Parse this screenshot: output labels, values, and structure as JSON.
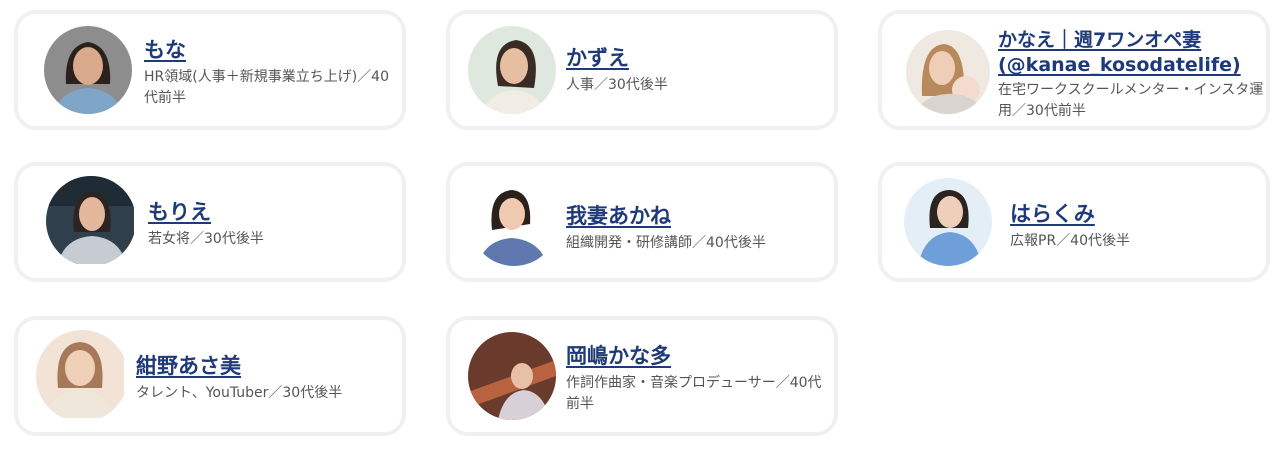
{
  "profiles": [
    {
      "name": "もな",
      "description": "HR領域(人事＋新規事業立ち上げ)／40代前半",
      "avatar_icon": "person-portrait-icon"
    },
    {
      "name": "かずえ",
      "description": "人事／30代後半",
      "avatar_icon": "person-portrait-icon"
    },
    {
      "name": "かなえ｜週7ワンオペ妻(@kanae_kosodatelife)",
      "description": "在宅ワークスクールメンター・インスタ運用／30代前半",
      "avatar_icon": "person-portrait-icon"
    },
    {
      "name": "もりえ",
      "description": "若女将／30代後半",
      "avatar_icon": "person-portrait-icon"
    },
    {
      "name": "我妻あかね",
      "description": "組織開発・研修講師／40代後半",
      "avatar_icon": "person-portrait-icon"
    },
    {
      "name": "はらくみ",
      "description": "広報PR／40代後半",
      "avatar_icon": "person-portrait-icon"
    },
    {
      "name": "紺野あさ美",
      "description": "タレント、YouTuber／30代後半",
      "avatar_icon": "person-portrait-icon"
    },
    {
      "name": "岡嶋かな多",
      "description": "作詞作曲家・音楽プロデューサー／40代前半",
      "avatar_icon": "person-portrait-icon"
    }
  ]
}
